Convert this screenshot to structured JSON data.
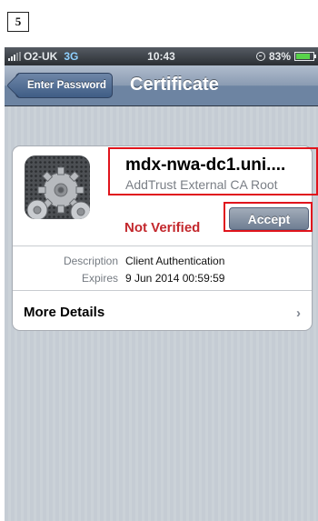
{
  "step_label": "5",
  "status_bar": {
    "carrier": "O2-UK",
    "network": "3G",
    "time": "10:43",
    "battery": "83%",
    "battery_level": 0.83
  },
  "nav": {
    "back_label": "Enter Password",
    "title": "Certificate"
  },
  "certificate": {
    "name": "mdx-nwa-dc1.uni....",
    "issuer": "AddTrust External CA Root",
    "status": "Not Verified",
    "accept_label": "Accept",
    "details": [
      {
        "label": "Description",
        "value": "Client Authentication"
      },
      {
        "label": "Expires",
        "value": "9 Jun 2014 00:59:59"
      }
    ],
    "more_label": "More Details",
    "more_icon": "chevron-right-icon"
  },
  "colors": {
    "highlight": "#e0141c",
    "not_verified": "#c3282d",
    "nav_bar": "#6d84a2"
  }
}
